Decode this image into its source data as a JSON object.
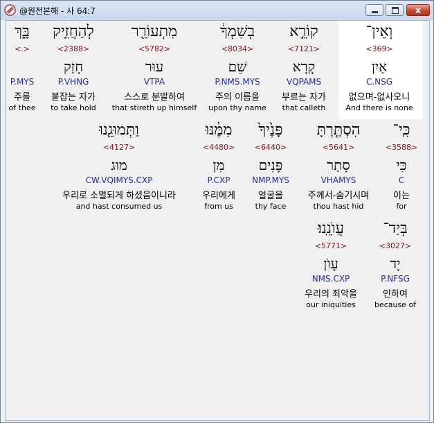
{
  "window": {
    "title": "@원전본해 - 사 64:7",
    "minimize_label": "",
    "maximize_label": "",
    "close_label": "x"
  },
  "rows": [
    [
      {
        "heb": "בָּ֑ךְ",
        "strong": "<.>",
        "lemma": "",
        "morph": "P.MYS",
        "kor": "주를",
        "eng": "of thee"
      },
      {
        "heb": "לְהַחֲזִ֣יק",
        "strong": "<2388>",
        "lemma": "חָזַק",
        "morph": "P.VHNG",
        "kor": "붙잡는 자가",
        "eng": "to take hold"
      },
      {
        "heb": "מִתְעוֹרֵ֖ר",
        "strong": "<5782>",
        "lemma": "עוּר",
        "morph": "VTPA",
        "kor": "스스로 분발하여",
        "eng": "that stireth up himself"
      },
      {
        "heb": "בְשִׁמְךָ֔",
        "strong": "<8034>",
        "lemma": "שֵׁם",
        "morph": "P.NMS.MYS",
        "kor": "주의 이름을",
        "eng": "upon thy name"
      },
      {
        "heb": "קוֹרֵ֣א",
        "strong": "<7121>",
        "lemma": "קָרָא",
        "morph": "VQPAMS",
        "kor": "부르는 자가",
        "eng": "that calleth"
      },
      {
        "heb": "וְאֵין־",
        "strong": "<369>",
        "lemma": "אַיִן",
        "morph": "C.NSG",
        "kor": "없으며-없사오니",
        "eng": "And there is none"
      }
    ],
    [
      {
        "heb": "וַתְּמוּגֵ֖נוּ",
        "strong": "<4127>",
        "lemma": "מוּג",
        "morph": "CW.VQIMYS.CXP",
        "kor": "우리로 소멸되게 하셨음이니라",
        "eng": "and hast consumed us"
      },
      {
        "heb": "מִמֶּ֔נּוּ",
        "strong": "<4480>",
        "lemma": "מִן",
        "morph": "P.CXP",
        "kor": "우리에게",
        "eng": "from us"
      },
      {
        "heb": "פָּנֶ֙יךָ֙",
        "strong": "<6440>",
        "lemma": "פָּנִים",
        "morph": "NMP.MYS",
        "kor": "얼굴을",
        "eng": "thy face"
      },
      {
        "heb": "הִסְתַּ֤רְתָּ",
        "strong": "<5641>",
        "lemma": "סָתַר",
        "morph": "VHAMYS",
        "kor": "주께서-숨기시며",
        "eng": "thou hast hid"
      },
      {
        "heb": "כִּֽי־",
        "strong": "<3588>",
        "lemma": "כִּי",
        "morph": "C",
        "kor": "이는",
        "eng": "for"
      }
    ],
    [
      {
        "heb": "עֲוֺנֵֽנוּ׃",
        "strong": "<5771>",
        "lemma": "עָוֺן",
        "morph": "NMS.CXP",
        "kor": "우리의 죄악을",
        "eng": "our iniquities"
      },
      {
        "heb": "בְּיַד־",
        "strong": "<3027>",
        "lemma": "יָד",
        "morph": "P.NFSG",
        "kor": "인하여",
        "eng": "because of"
      }
    ]
  ]
}
